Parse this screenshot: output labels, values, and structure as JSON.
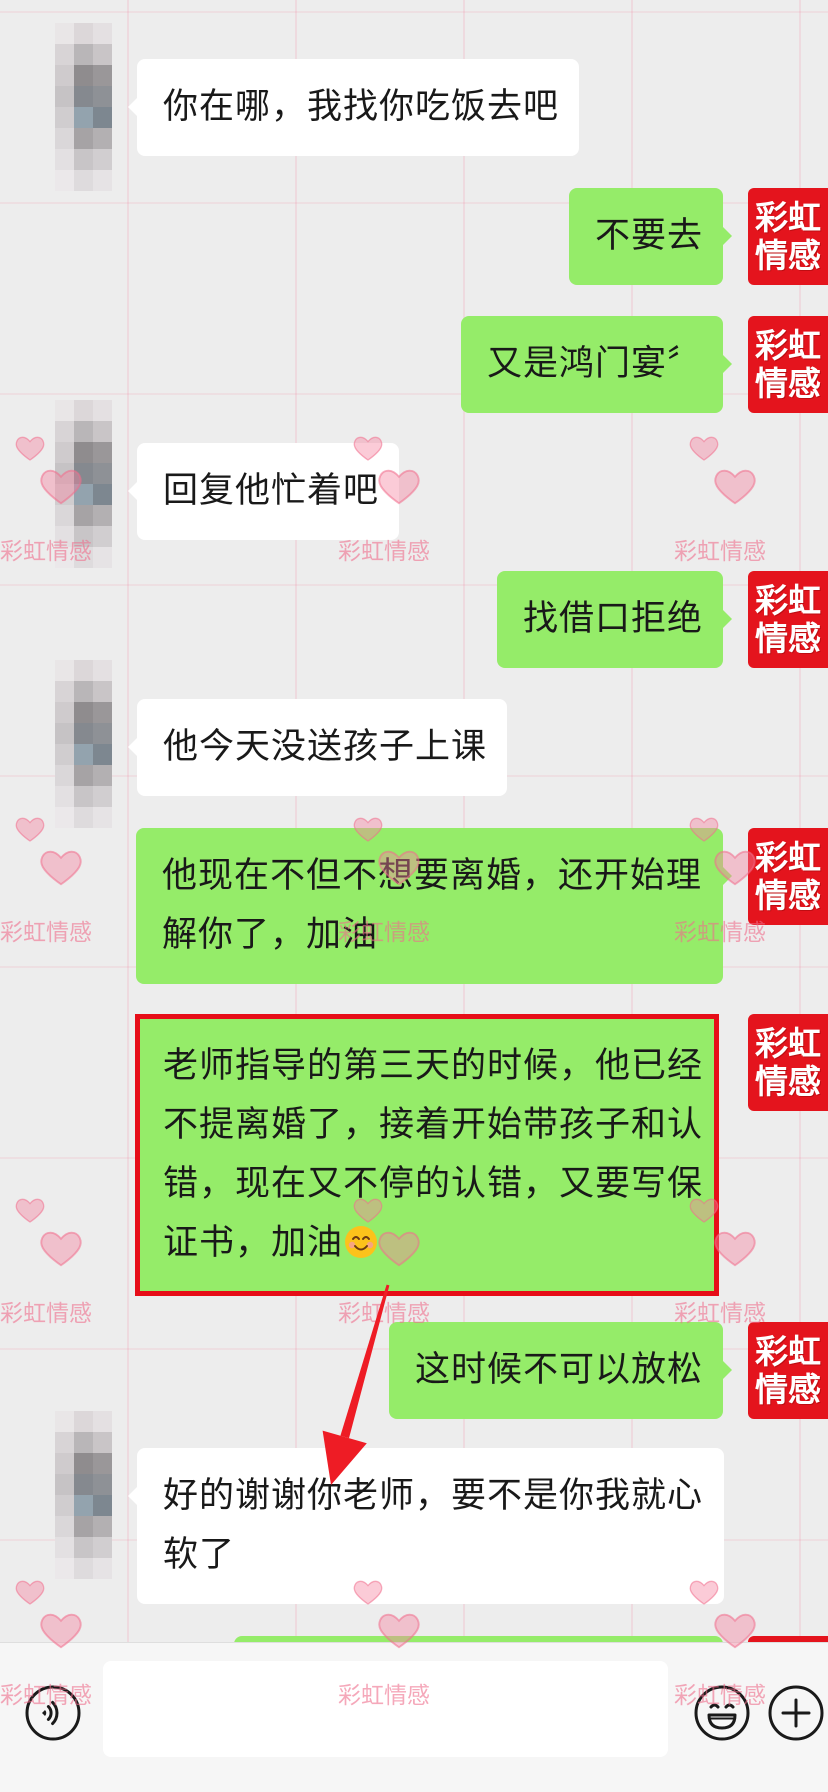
{
  "colors": {
    "background": "#ededed",
    "incoming_bubble": "#ffffff",
    "outgoing_bubble": "#95ec69",
    "highlight_border": "#e60d18",
    "self_avatar": "#e4141d",
    "arrow": "#ee1c25"
  },
  "messages": [
    {
      "side": "left",
      "text": "你在哪，我找你吃饭去吧"
    },
    {
      "side": "right",
      "text": "不要去"
    },
    {
      "side": "right",
      "text": "又是鸿门宴〞"
    },
    {
      "side": "left",
      "text": "回复他忙着吧"
    },
    {
      "side": "right",
      "text": "找借口拒绝"
    },
    {
      "side": "left",
      "text": "他今天没送孩子上课"
    },
    {
      "side": "right",
      "text": "他现在不但不想要离婚，还开始理解你了，加油"
    },
    {
      "side": "right",
      "text": "老师指导的第三天的时候，他已经不提离婚了，接着开始带孩子和认错，现在又不停的认错，又要写保证书，加油",
      "emoji": "smiling-face-icon",
      "highlighted": true
    },
    {
      "side": "right",
      "text": "这时候不可以放松"
    },
    {
      "side": "left",
      "text": "好的谢谢你老师，要不是你我就心软了"
    }
  ],
  "self_avatar": {
    "line1": "彩虹",
    "line2": "情感"
  },
  "watermark": {
    "text": "彩虹情感",
    "icon": "heart-icon"
  },
  "annotation": {
    "arrow_icon": "red-arrow-icon"
  },
  "input_bar": {
    "value": "",
    "voice_icon": "voice-icon",
    "emoji_icon": "emoji-icon",
    "plus_icon": "plus-icon"
  }
}
